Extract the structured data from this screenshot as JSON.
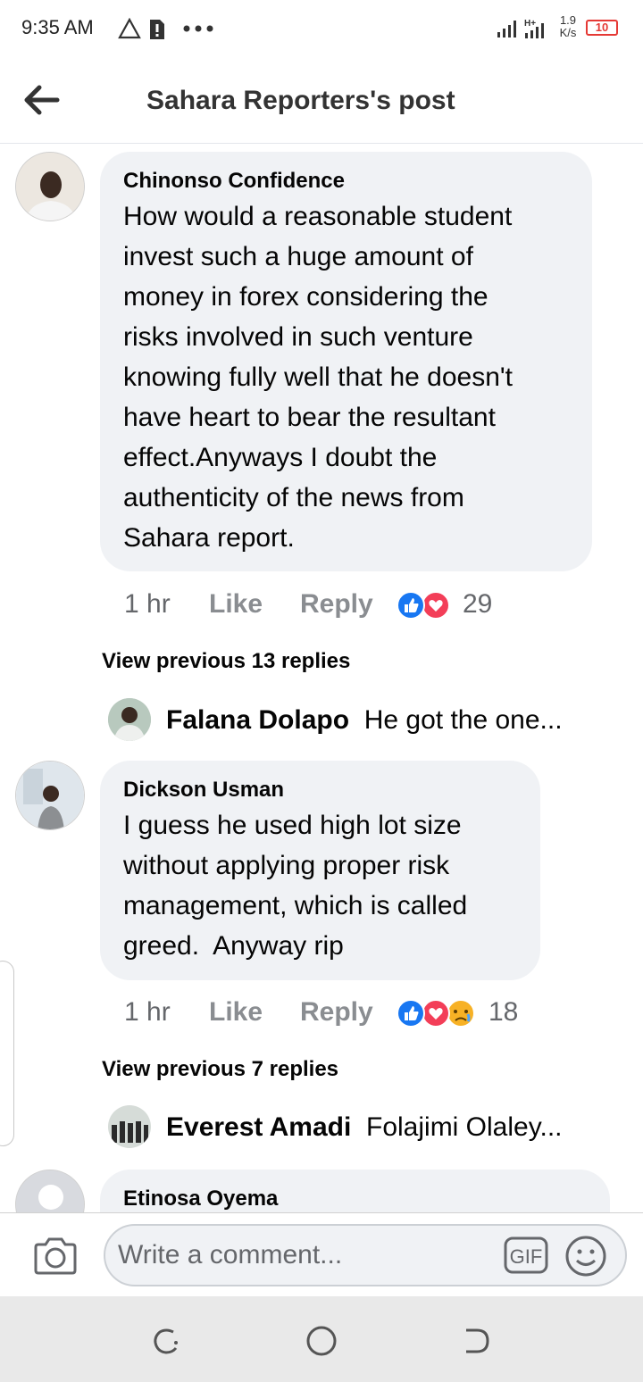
{
  "status_bar": {
    "time": "9:35 AM",
    "net_speed_value": "1.9",
    "net_speed_unit": "K/s",
    "battery": "10",
    "icons": [
      "warning-icon",
      "sim-alert-icon",
      "more-dots-icon",
      "signal-icon",
      "hplus-signal-icon",
      "battery-icon"
    ]
  },
  "header": {
    "title": "Sahara Reporters's post",
    "back_icon": "arrow-left-icon"
  },
  "comments": [
    {
      "author": "Chinonso Confidence",
      "text": "How would a reasonable student\ninvest such a huge amount of\nmoney in forex considering the\nrisks involved in such venture\nknowing fully well that he doesn't\nhave heart to bear the resultant\neffect.Anyways I doubt the\nauthenticity of the news from\nSahara report.",
      "time": "1 hr",
      "like_label": "Like",
      "reply_label": "Reply",
      "reaction_count": "29",
      "reactions": [
        "like-reaction-icon",
        "love-reaction-icon"
      ],
      "view_previous": "View previous 13 replies",
      "reply_preview": {
        "name": "Falana Dolapo",
        "text": "He got the one..."
      }
    },
    {
      "author": "Dickson Usman",
      "text": "I guess he used high lot size\nwithout applying proper risk\nmanagement, which is called\ngreed.  Anyway rip",
      "time": "1 hr",
      "like_label": "Like",
      "reply_label": "Reply",
      "reaction_count": "18",
      "reactions": [
        "like-reaction-icon",
        "love-reaction-icon",
        "sad-reaction-icon"
      ],
      "view_previous": "View previous 7 replies",
      "reply_preview": {
        "name": "Everest Amadi",
        "text": "Folajimi Olaley..."
      }
    },
    {
      "author": "Etinosa Oyema"
    }
  ],
  "composer": {
    "placeholder": "Write a comment...",
    "gif_label": "GIF"
  },
  "colors": {
    "bubble": "#f0f2f5",
    "like_blue": "#1877f2",
    "love_red": "#f33e58",
    "sad_yellow": "#f7b125",
    "meta_gray": "#8a8d91"
  }
}
